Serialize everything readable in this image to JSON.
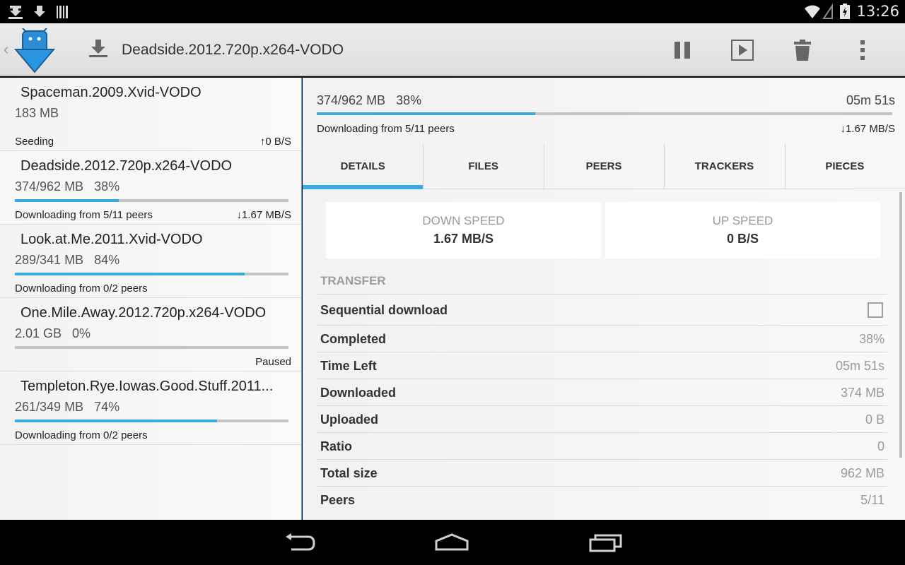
{
  "status_bar": {
    "time": "13:26",
    "left_icons": [
      "utorrent-notification-icon",
      "download-notification-icon",
      "barcode-notification-icon"
    ],
    "right_icons": [
      "wifi-icon",
      "battery-icon"
    ]
  },
  "action_bar": {
    "title": "Deadside.2012.720p.x264-VODO",
    "actions": [
      "pause-icon",
      "play-icon",
      "trash-icon",
      "overflow-menu-icon"
    ]
  },
  "torrents": [
    {
      "name": "Spaceman.2009.Xvid-VODO",
      "size": "183 MB",
      "progress": null,
      "status": "Seeding",
      "rate": "↑0 B/S"
    },
    {
      "name": "Deadside.2012.720p.x264-VODO",
      "size": "374/962 MB   38%",
      "progress": 0.38,
      "status": "Downloading from 5/11 peers",
      "rate": "↓1.67 MB/S"
    },
    {
      "name": "Look.at.Me.2011.Xvid-VODO",
      "size": "289/341 MB   84%",
      "progress": 0.84,
      "status": "Downloading from 0/2 peers",
      "rate": ""
    },
    {
      "name": "One.Mile.Away.2012.720p.x264-VODO",
      "size": "2.01 GB   0%",
      "progress": 0.0,
      "status": "",
      "rate": "Paused"
    },
    {
      "name": "Templeton.Rye.Iowas.Good.Stuff.2011...",
      "size": "261/349 MB   74%",
      "progress": 0.74,
      "status": "Downloading from 0/2 peers",
      "rate": ""
    }
  ],
  "detail": {
    "progress_text": "374/962 MB   38%",
    "progress": 0.38,
    "eta": "05m 51s",
    "status": "Downloading from 5/11 peers",
    "rate": "↓1.67 MB/S",
    "tabs": [
      "DETAILS",
      "FILES",
      "PEERS",
      "TRACKERS",
      "PIECES"
    ],
    "selected_tab": "DETAILS",
    "down_speed_label": "DOWN SPEED",
    "down_speed_value": "1.67 MB/S",
    "up_speed_label": "UP SPEED",
    "up_speed_value": "0 B/S",
    "section_title": "TRANSFER",
    "sequential_label": "Sequential download",
    "sequential_checked": false,
    "rows": [
      {
        "label": "Completed",
        "value": "38%"
      },
      {
        "label": "Time Left",
        "value": "05m 51s"
      },
      {
        "label": "Downloaded",
        "value": "374 MB"
      },
      {
        "label": "Uploaded",
        "value": "0 B"
      },
      {
        "label": "Ratio",
        "value": "0"
      },
      {
        "label": "Total size",
        "value": "962 MB"
      },
      {
        "label": "Peers",
        "value": "5/11"
      }
    ]
  },
  "colors": {
    "accent": "#39a9e0",
    "progress_track": "#c4c4c4"
  },
  "nav_bar": [
    "back-icon",
    "home-icon",
    "recent-apps-icon"
  ]
}
